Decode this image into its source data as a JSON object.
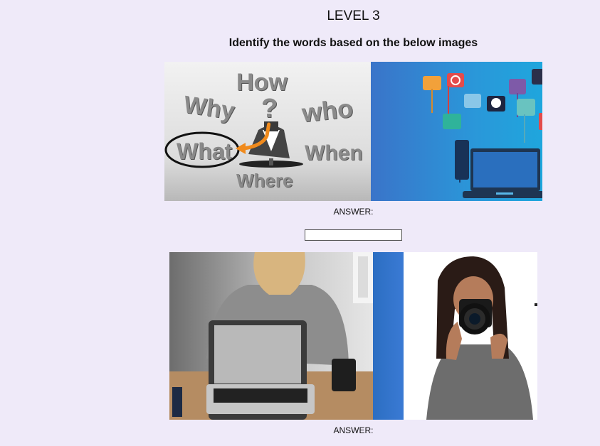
{
  "level": {
    "title": "LEVEL 3"
  },
  "instructions": "Identify the words based on the below images",
  "puzzle1": {
    "answer_label": "ANSWER:",
    "answer_value": "",
    "words": [
      "How",
      "Why",
      "?",
      "who",
      "What",
      "When",
      "Where"
    ]
  },
  "puzzle2": {
    "answer_label": "ANSWER:"
  }
}
